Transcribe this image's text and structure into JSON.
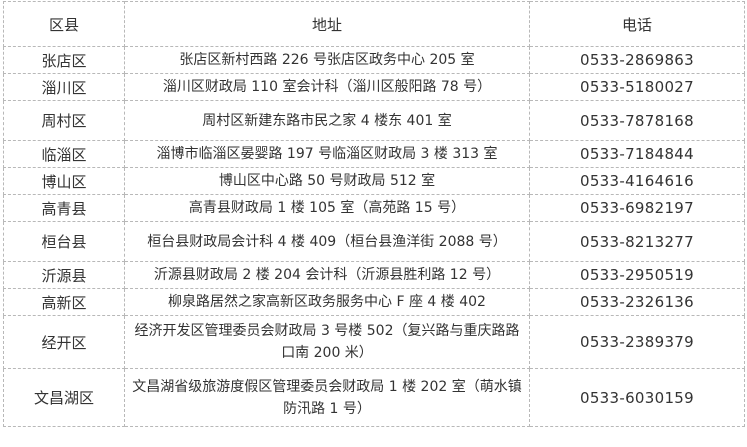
{
  "table": {
    "headers": [
      "区县",
      "地址",
      "电话"
    ],
    "rows": [
      {
        "district": "张店区",
        "address": "张店区新村西路 226 号张店区政务中心 205 室",
        "phone": "0533-2869863"
      },
      {
        "district": "淄川区",
        "address": "淄川区财政局 110 室会计科（淄川区般阳路 78 号）",
        "phone": "0533-5180027"
      },
      {
        "district": "周村区",
        "address": "周村区新建东路市民之家 4 楼东 401 室",
        "phone": "0533-7878168"
      },
      {
        "district": "临淄区",
        "address": "淄博市临淄区晏婴路 197 号临淄区财政局 3 楼 313 室",
        "phone": "0533-7184844"
      },
      {
        "district": "博山区",
        "address": "博山区中心路 50 号财政局 512 室",
        "phone": "0533-4164616"
      },
      {
        "district": "高青县",
        "address": "高青县财政局 1 楼 105 室（高苑路 15 号）",
        "phone": "0533-6982197"
      },
      {
        "district": "桓台县",
        "address": "桓台县财政局会计科 4 楼 409（桓台县渔洋街 2088 号）",
        "phone": "0533-8213277"
      },
      {
        "district": "沂源县",
        "address": "沂源县财政局 2 楼 204 会计科（沂源县胜利路 12 号）",
        "phone": "0533-2950519"
      },
      {
        "district": "高新区",
        "address": "柳泉路居然之家高新区政务服务中心 F 座 4 楼 402",
        "phone": "0533-2326136"
      },
      {
        "district": "经开区",
        "address": "经济开发区管理委员会财政局 3 号楼 502（复兴路与重庆路路口南 200 米）",
        "phone": "0533-2389379"
      },
      {
        "district": "文昌湖区",
        "address": "文昌湖省级旅游度假区管理委员会财政局 1 楼 202 室（萌水镇防汛路 1 号）",
        "phone": "0533-6030159"
      }
    ]
  }
}
